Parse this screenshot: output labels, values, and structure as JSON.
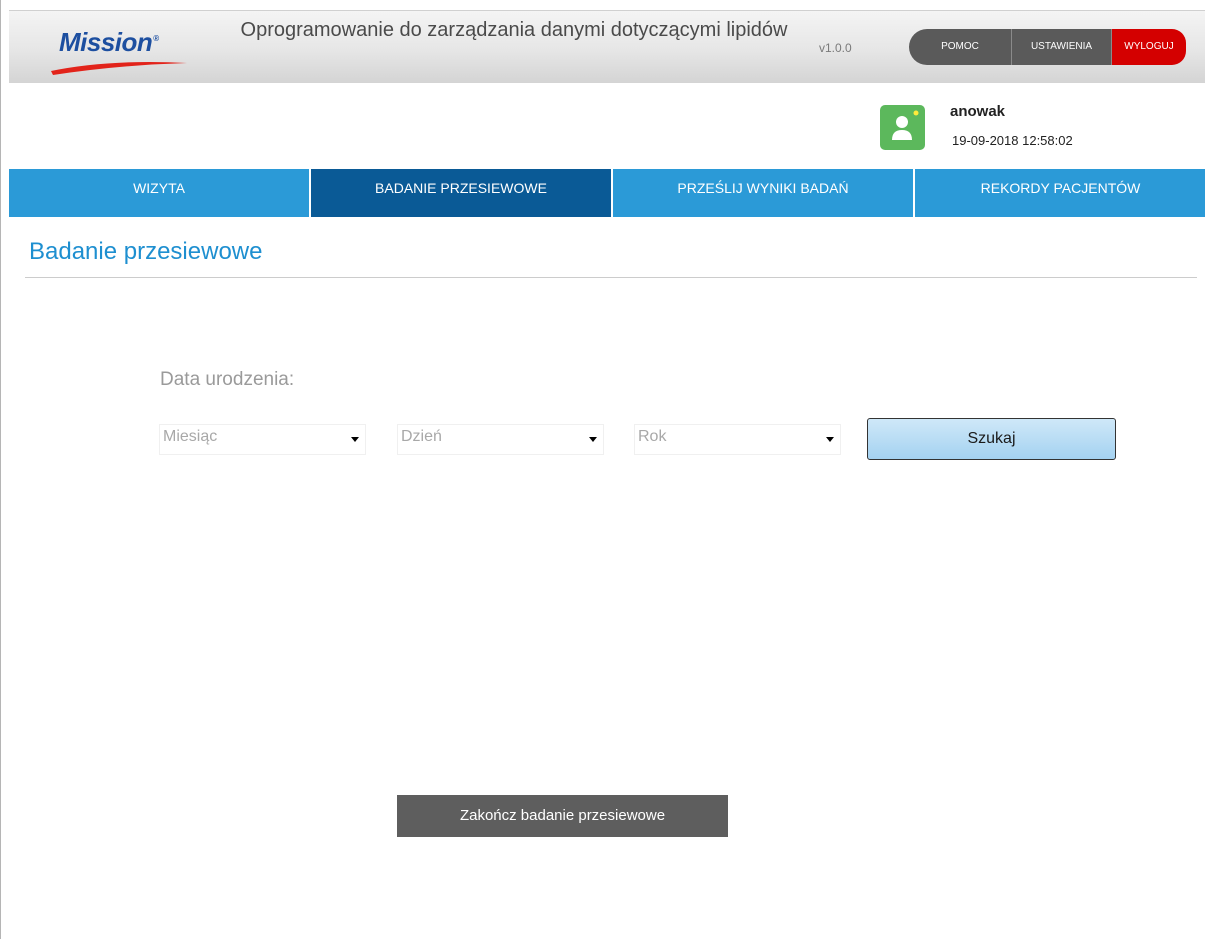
{
  "header": {
    "logo_text": "Mission",
    "logo_reg": "®",
    "title": "Oprogramowanie do zarządzania danymi dotyczącymi lipidów",
    "version": "v1.0.0",
    "buttons": {
      "help": "POMOC",
      "settings": "USTAWIENIA",
      "logout": "WYLOGUJ"
    }
  },
  "user": {
    "name": "anowak",
    "datetime": "19-09-2018 12:58:02",
    "avatar_icon": "user-icon"
  },
  "nav": {
    "tabs": [
      {
        "label": "WIZYTA",
        "active": false
      },
      {
        "label": "BADANIE PRZESIEWOWE",
        "active": true
      },
      {
        "label": "PRZEŚLIJ WYNIKI BADAŃ",
        "active": false
      },
      {
        "label": "REKORDY PACJENTÓW",
        "active": false
      }
    ]
  },
  "page": {
    "title": "Badanie przesiewowe",
    "dob_label": "Data urodzenia:",
    "selects": {
      "month": "Miesiąc",
      "day": "Dzień",
      "year": "Rok"
    },
    "search_label": "Szukaj",
    "finish_label": "Zakończ badanie przesiewowe"
  },
  "colors": {
    "nav_bg": "#2b9ad7",
    "nav_active": "#0a5a96",
    "logout": "#d40000",
    "title": "#1e8fd0",
    "avatar": "#5cb85c"
  }
}
